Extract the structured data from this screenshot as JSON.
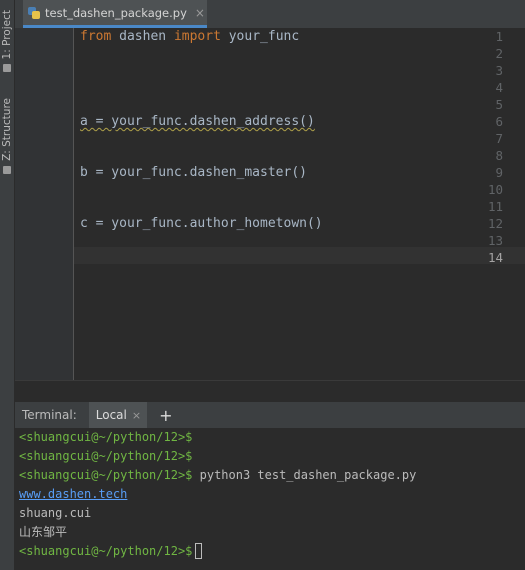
{
  "side": {
    "project_label": "1: Project",
    "structure_label": "Z: Structure"
  },
  "editor": {
    "tab": {
      "file_name": "test_dashen_package.py",
      "close": "×"
    },
    "current_line": "14",
    "lines": [
      {
        "n": "1",
        "kw1": "from",
        "t1": " dashen ",
        "kw2": "import",
        "t2": " your_func"
      },
      {
        "n": "2",
        "text": ""
      },
      {
        "n": "3",
        "text": ""
      },
      {
        "n": "4",
        "text": ""
      },
      {
        "n": "5",
        "text": ""
      },
      {
        "n": "6",
        "text": "a = your_func.dashen_address()"
      },
      {
        "n": "7",
        "text": ""
      },
      {
        "n": "8",
        "text": ""
      },
      {
        "n": "9",
        "text": "b = your_func.dashen_master()"
      },
      {
        "n": "10",
        "text": ""
      },
      {
        "n": "11",
        "text": ""
      },
      {
        "n": "12",
        "text": "c = your_func.author_hometown()"
      },
      {
        "n": "13",
        "text": ""
      },
      {
        "n": "14",
        "text": ""
      }
    ]
  },
  "terminal": {
    "label": "Terminal:",
    "tab": "Local",
    "tab_close": "×",
    "add": "+",
    "lines": [
      {
        "prompt": "<shuangcui@~/python/12>$",
        "cmd": ""
      },
      {
        "prompt": "<shuangcui@~/python/12>$",
        "cmd": ""
      },
      {
        "prompt": "<shuangcui@~/python/12>$",
        "cmd": " python3 test_dashen_package.py"
      },
      {
        "link": "www.dashen.tech"
      },
      {
        "text": "shuang.cui"
      },
      {
        "text": "山东邹平"
      },
      {
        "prompt": "<shuangcui@~/python/12>$",
        "cmd": ""
      }
    ]
  },
  "colors": {
    "keyword": "#cc7832",
    "code_text": "#a9b7c6",
    "prompt": "#70b643",
    "link": "#589df6",
    "tab_underline": "#4a88c7"
  }
}
